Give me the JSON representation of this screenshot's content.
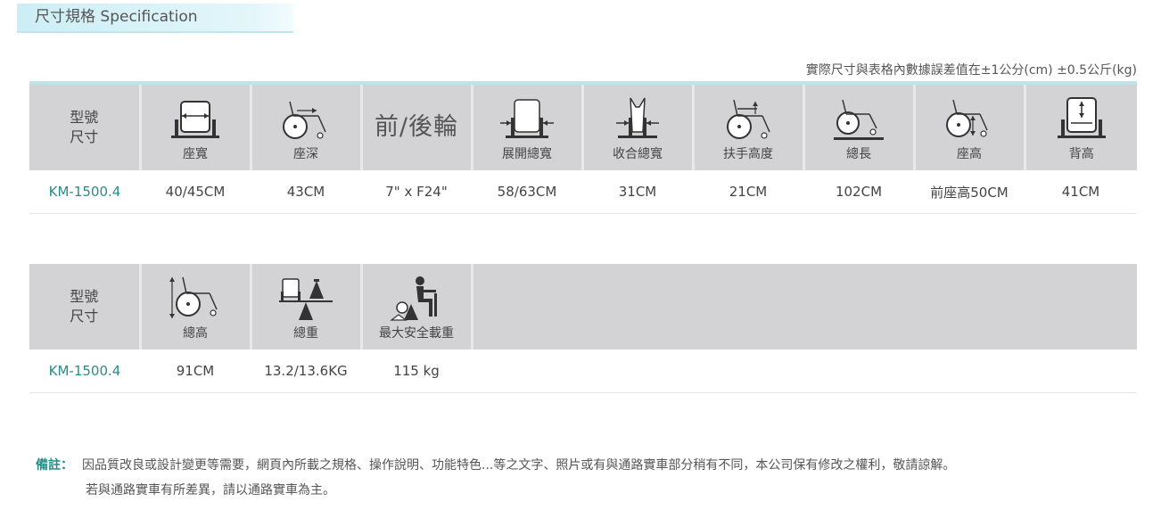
{
  "section_title": "尺寸規格 Specification",
  "tolerance_note": "實際尺寸與表格內數據誤差值在±1公分(cm) ±0.5公斤(kg)",
  "header_label_line1": "型號",
  "header_label_line2": "尺寸",
  "table1": {
    "columns": [
      {
        "caption": "座寬",
        "icon": "seat-width-icon"
      },
      {
        "caption": "座深",
        "icon": "seat-depth-icon"
      },
      {
        "caption": "前/後輪",
        "icon": "none"
      },
      {
        "caption": "展開總寬",
        "icon": "unfolded-width-icon"
      },
      {
        "caption": "收合總寬",
        "icon": "folded-width-icon"
      },
      {
        "caption": "扶手高度",
        "icon": "armrest-height-icon"
      },
      {
        "caption": "總長",
        "icon": "total-length-icon"
      },
      {
        "caption": "座高",
        "icon": "seat-height-icon"
      },
      {
        "caption": "背高",
        "icon": "back-height-icon"
      }
    ],
    "model": "KM-1500.4",
    "values": [
      "40/45CM",
      "43CM",
      "7\" x F24\"",
      "58/63CM",
      "31CM",
      "21CM",
      "102CM",
      "前座高50CM",
      "41CM"
    ]
  },
  "table2": {
    "columns": [
      {
        "caption": "總高",
        "icon": "total-height-icon"
      },
      {
        "caption": "總重",
        "icon": "total-weight-icon"
      },
      {
        "caption": "最大安全載重",
        "icon": "max-load-icon"
      }
    ],
    "model": "KM-1500.4",
    "values": [
      "91CM",
      "13.2/13.6KG",
      "115 kg"
    ]
  },
  "remark": {
    "label": "備註：",
    "line1": "因品質改良或設計變更等需要，網頁內所載之規格、操作說明、功能特色...等之文字、照片或有與通路實車部分稍有不同，本公司保有修改之權利，敬請諒解。",
    "line2": "若與通路實車有所差異，請以通路實車為主。"
  }
}
